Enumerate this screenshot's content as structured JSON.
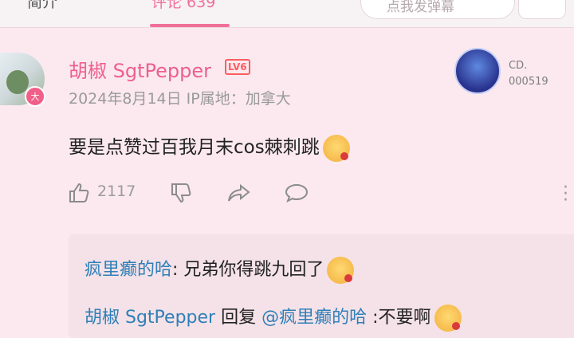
{
  "tabs": {
    "left": "简介",
    "active": "评论 639"
  },
  "danmu": {
    "placeholder": "点我发弹幕"
  },
  "comment": {
    "username": "胡椒 SgtPepper",
    "level": "LV6",
    "badge": "大",
    "meta": "2024年8月14日  IP属地：加拿大",
    "medal_label_1": "CD.",
    "medal_label_2": "000519",
    "text": "要是点赞过百我月末cos棘刺跳",
    "likes": "2117"
  },
  "replies": [
    {
      "user": "疯里癫的哈",
      "sep": ": ",
      "text": "兄弟你得跳九回了"
    },
    {
      "user": "胡椒 SgtPepper",
      "verb": " 回复 ",
      "target": "@疯里癫的哈",
      "text": " :不要啊"
    }
  ],
  "colors": {
    "accent": "#f0709a",
    "username": "#ee5f8f",
    "link": "#2f7fb8"
  }
}
